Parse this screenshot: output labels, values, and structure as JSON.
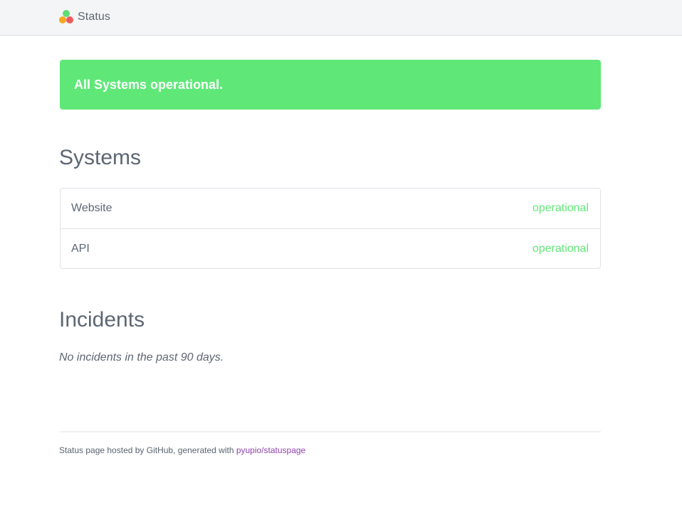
{
  "header": {
    "brand_label": "Status",
    "logo_icon": "three-dots-logo-icon",
    "logo_colors": {
      "top": "#5fdc72",
      "left": "#f5a623",
      "right": "#f0595b"
    }
  },
  "banner": {
    "text": "All Systems operational.",
    "color": "#5fe878"
  },
  "systems": {
    "title": "Systems",
    "items": [
      {
        "name": "Website",
        "status": "operational"
      },
      {
        "name": "API",
        "status": "operational"
      }
    ],
    "status_color": "#5fe878"
  },
  "incidents": {
    "title": "Incidents",
    "empty_text": "No incidents in the past 90 days."
  },
  "footer": {
    "text": "Status page hosted by GitHub, generated with",
    "link_label": "pyupio/statuspage",
    "link_color": "#8e44ad"
  }
}
